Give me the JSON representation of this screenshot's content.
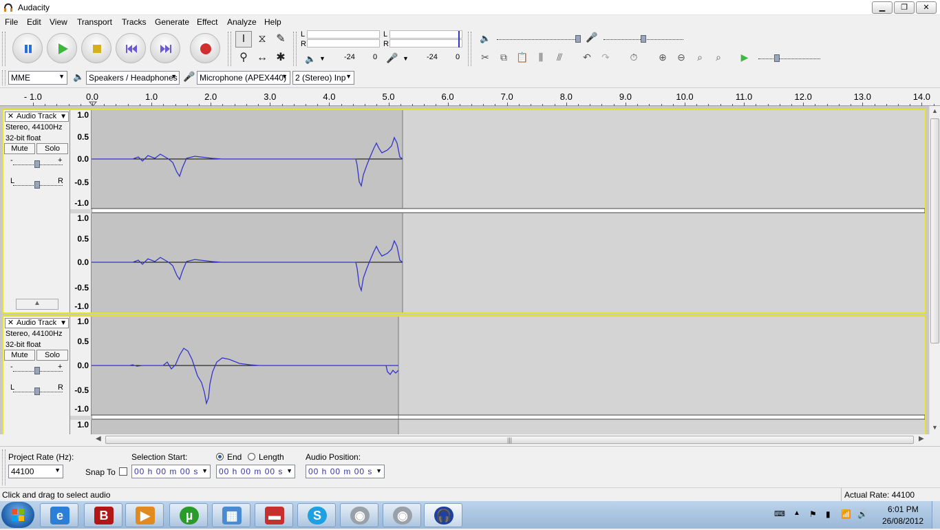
{
  "window": {
    "title": "Audacity",
    "min": "▭",
    "max": "❐",
    "close": "✕"
  },
  "menu": [
    "File",
    "Edit",
    "View",
    "Transport",
    "Tracks",
    "Generate",
    "Effect",
    "Analyze",
    "Help"
  ],
  "meter": {
    "play_l": "L",
    "play_r": "R",
    "rec_l": "L",
    "rec_r": "R",
    "play_scale_left": "-24",
    "play_scale_right": "0",
    "rec_scale_left": "-24",
    "rec_scale_right": "0"
  },
  "devices": {
    "host": "MME",
    "output": "Speakers / Headphones",
    "input": "Microphone (APEX440)",
    "channels": "2 (Stereo) Inp"
  },
  "ruler": {
    "labels": [
      "- 1.0",
      "0.0",
      "1.0",
      "2.0",
      "3.0",
      "4.0",
      "5.0",
      "6.0",
      "7.0",
      "8.0",
      "9.0",
      "10.0",
      "11.0",
      "12.0",
      "13.0",
      "14.0"
    ],
    "values": [
      -1,
      0,
      1,
      2,
      3,
      4,
      5,
      6,
      7,
      8,
      9,
      10,
      11,
      12,
      13,
      14
    ]
  },
  "tracks": [
    {
      "name": "Audio Track",
      "format": "Stereo, 44100Hz",
      "depth": "32-bit float",
      "mute": "Mute",
      "solo": "Solo",
      "gain_minus": "-",
      "gain_plus": "+",
      "pan_l": "L",
      "pan_r": "R",
      "scale": [
        "1.0",
        "0.5",
        "0.0",
        "-0.5",
        "-1.0"
      ]
    },
    {
      "name": "Audio Track",
      "format": "Stereo, 44100Hz",
      "depth": "32-bit float",
      "mute": "Mute",
      "solo": "Solo",
      "gain_minus": "-",
      "gain_plus": "+",
      "pan_l": "L",
      "pan_r": "R",
      "scale": [
        "1.0",
        "0.5",
        "0.0",
        "-0.5",
        "-1.0"
      ],
      "scale2_top": "1.0"
    }
  ],
  "selection": {
    "project_rate_label": "Project Rate (Hz):",
    "project_rate": "44100",
    "snap_to": "Snap To",
    "selection_start_label": "Selection Start:",
    "end_label": "End",
    "length_label": "Length",
    "audio_position_label": "Audio Position:",
    "start_value": "00 h 00 m 00 s",
    "end_value": "00 h 00 m 00 s",
    "position_value": "00 h 00 m 00 s"
  },
  "status": {
    "left": "Click and drag to select audio",
    "right": "Actual Rate: 44100"
  },
  "taskbar": {
    "time": "6:01 PM",
    "date": "26/08/2012"
  },
  "colors": {
    "waveform": "#3333cc",
    "selection_border": "#e8e030",
    "taskbar": "#a9c4e2"
  }
}
